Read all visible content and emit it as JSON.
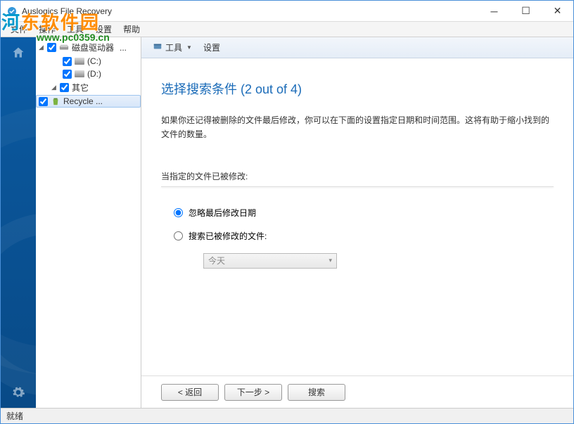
{
  "title": "Auslogics File Recovery",
  "menubar": [
    "文件",
    "操作",
    "工具",
    "设置",
    "帮助"
  ],
  "watermark": {
    "brand": "河东软件园",
    "url": "www.pc0359.cn"
  },
  "tree": {
    "root": {
      "label": "磁盘驱动器",
      "ellipsis": "..."
    },
    "drives": [
      {
        "label": "(C:)"
      },
      {
        "label": "(D:)"
      }
    ],
    "other": {
      "label": "其它"
    },
    "recycle": {
      "label": "Recycle ..."
    }
  },
  "toolbar": {
    "tools": "工具",
    "settings": "设置"
  },
  "page": {
    "title": "选择搜索条件 (2 out of 4)",
    "description": "如果你还记得被删除的文件最后修改，你可以在下面的设置指定日期和时间范围。这将有助于缩小找到的文件的数量。",
    "section_label": "当指定的文件已被修改:",
    "radio_ignore": "忽略最后修改日期",
    "radio_search": "搜索已被修改的文件:",
    "dropdown_value": "今天"
  },
  "buttons": {
    "back": "< 返回",
    "next": "下一步 >",
    "search": "搜索"
  },
  "status": "就绪"
}
